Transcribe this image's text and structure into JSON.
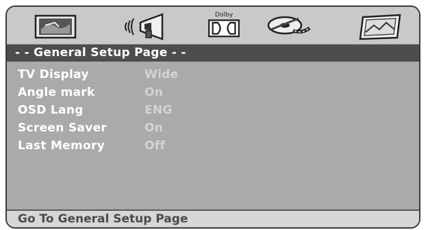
{
  "icons": [
    "general-setup-icon",
    "audio-setup-icon",
    "dolby-setup-icon",
    "video-setup-icon",
    "preference-icon"
  ],
  "dolby_label": "Dolby",
  "page_title": "- - General Setup Page - -",
  "menu": [
    {
      "label": "TV Display",
      "value": "Wide"
    },
    {
      "label": "Angle mark",
      "value": "On"
    },
    {
      "label": "OSD Lang",
      "value": "ENG"
    },
    {
      "label": "Screen Saver",
      "value": "On"
    },
    {
      "label": "Last Memory",
      "value": "Off"
    }
  ],
  "status": "Go To General Setup Page",
  "colors": {
    "title_bar": "#4d4d4d",
    "panel": "#aaaaaa",
    "label": "#ffffff",
    "value": "#d4d4d4"
  }
}
